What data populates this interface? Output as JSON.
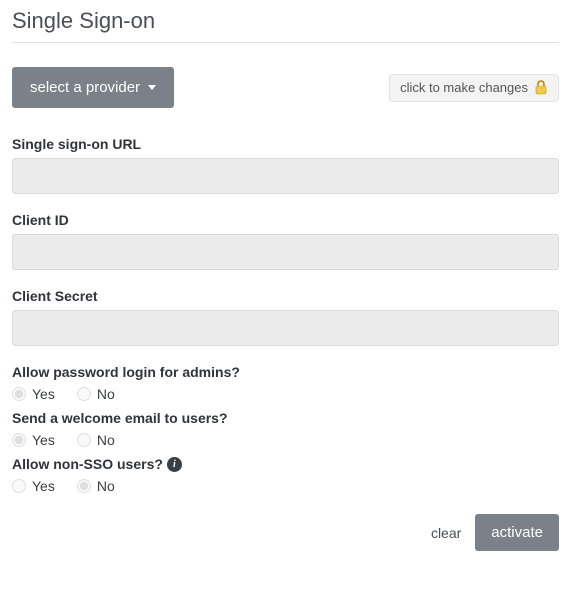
{
  "page": {
    "title": "Single Sign-on"
  },
  "toolbar": {
    "provider_dropdown_label": "select a provider",
    "lock_badge_label": "click to make changes"
  },
  "fields": {
    "sso_url": {
      "label": "Single sign-on URL",
      "value": ""
    },
    "client_id": {
      "label": "Client ID",
      "value": ""
    },
    "client_secret": {
      "label": "Client Secret",
      "value": ""
    }
  },
  "radios": {
    "admin_password_login": {
      "label": "Allow password login for admins?",
      "yes": "Yes",
      "no": "No",
      "selected": "yes"
    },
    "welcome_email": {
      "label": "Send a welcome email to users?",
      "yes": "Yes",
      "no": "No",
      "selected": "yes"
    },
    "non_sso_users": {
      "label": "Allow non-SSO users?",
      "yes": "Yes",
      "no": "No",
      "selected": "no"
    }
  },
  "footer": {
    "clear_label": "clear",
    "activate_label": "activate"
  },
  "icons": {
    "caret_down": "caret-down-icon",
    "lock": "lock-icon",
    "info": "i"
  }
}
